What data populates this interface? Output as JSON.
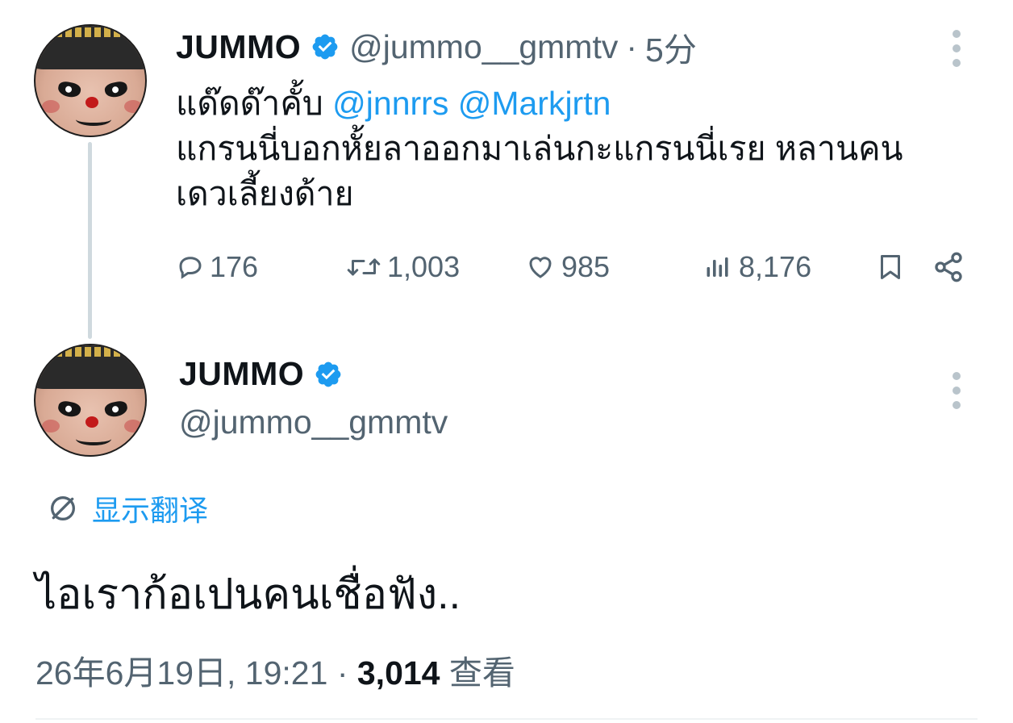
{
  "tweet1": {
    "display_name": "JUMMO",
    "handle": "@jummo__gmmtv",
    "separator": "·",
    "time": "5分",
    "text_prefix": "แด๊ดด๊าคั้บ ",
    "mention1": "@jnnrrs",
    "mention2": "@Markjrtn",
    "line2": "แกรนนี่บอกหั้ยลาออกมาเล่นกะแกรนนี่เรย หลานคน",
    "line3": "เดวเลี้ยงด้าย",
    "replies": "176",
    "retweets": "1,003",
    "likes": "985",
    "views": "8,176"
  },
  "tweet2": {
    "display_name": "JUMMO",
    "handle": "@jummo__gmmtv",
    "translate_label": "显示翻译",
    "text": "ไอเราก้อเปนคนเชื่อฟัง..",
    "date": "26年6月19日, 19:21",
    "separator": "·",
    "view_count": "3,014",
    "view_label": "查看"
  },
  "colors": {
    "accent": "#1d9bf0",
    "text": "#0f1419",
    "secondary": "#536471",
    "thread_line": "#cfd9de"
  },
  "icons": [
    "verified-badge-icon",
    "more-dots-icon",
    "reply-icon",
    "retweet-icon",
    "like-icon",
    "views-icon",
    "bookmark-icon",
    "share-icon",
    "translate-icon"
  ]
}
